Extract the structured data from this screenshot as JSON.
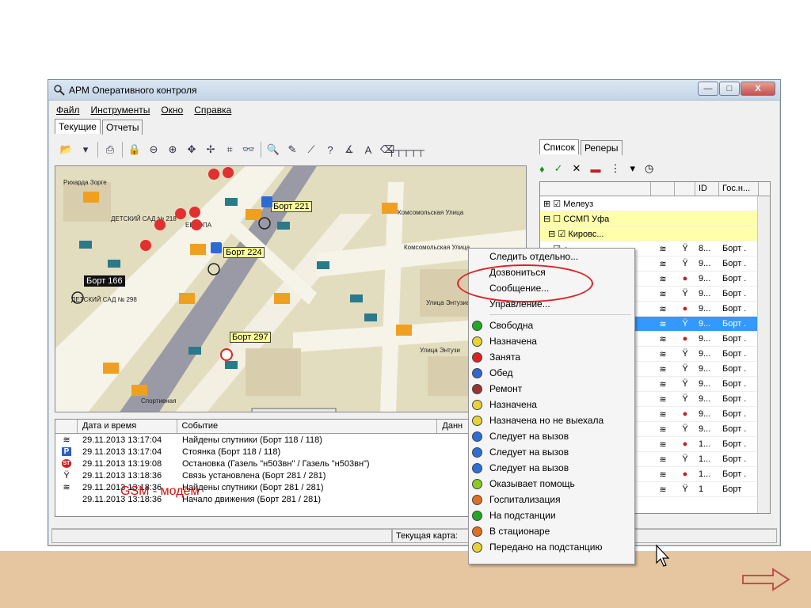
{
  "window": {
    "title": "АРМ Оперативного контроля",
    "buttons": {
      "minimize": "—",
      "maximize": "□",
      "close": "X"
    }
  },
  "menu": [
    "Файл",
    "Инструменты",
    "Окно",
    "Справка"
  ],
  "tabs": [
    "Текущие",
    "Отчеты"
  ],
  "map": {
    "streets": [
      "Рихарда Зорге",
      "Комсомольская Улица",
      "Комсомольская Улица",
      "Улица Энтузиаст",
      "Улица Энтузи",
      "Спортивная",
      "ДЕТСКИЙ САД № 218",
      "ДЕТСКИЙ САД № 298",
      "ЕВРОПА"
    ],
    "borts": [
      "Борт 221",
      "Борт 224",
      "Борт 166",
      "Борт 297"
    ]
  },
  "events": {
    "headers": [
      "Дата и время",
      "Событие",
      "Данн"
    ],
    "rows": [
      {
        "icon": "satellite-icon",
        "date": "29.11.2013 13:17:04",
        "event": "Найдены спутники (Борт 118 / 118)"
      },
      {
        "icon": "parking-icon",
        "date": "29.11.2013 13:17:04",
        "event": "Стоянка (Борт 118 / 118)"
      },
      {
        "icon": "stop-icon",
        "date": "29.11.2013 13:19:08",
        "event": "Остановка (Газель \"н503вн\" / Газель \"н503вн\")"
      },
      {
        "icon": "antenna-icon",
        "date": "29.11.2013 13:18:36",
        "event": "Связь установлена (Борт 281 / 281)"
      },
      {
        "icon": "satellite-icon",
        "date": "29.11.2013 13:18:36",
        "event": "Найдены спутники (Борт 281 / 281)"
      },
      {
        "icon": "none",
        "date": "29.11.2013 13:18:36",
        "event": "Начало движения (Борт 281 / 281)"
      }
    ]
  },
  "status": {
    "current_map": "Текущая карта: "
  },
  "right_panel": {
    "tabs": [
      "Список",
      "Реперы"
    ],
    "headers": [
      "ID",
      "Гос.н..."
    ],
    "tree": [
      {
        "label": "Мелеуз",
        "style": "plain"
      },
      {
        "label": "ССМП Уфа",
        "style": "yellow"
      },
      {
        "label": "Кировс...",
        "style": "yellow"
      }
    ],
    "rows": [
      {
        "id": "8...",
        "gos": "Борт ."
      },
      {
        "id": "9...",
        "gos": "Борт ."
      },
      {
        "id": "9...",
        "gos": "Борт ."
      },
      {
        "id": "9...",
        "gos": "Борт ."
      },
      {
        "id": "9...",
        "gos": "Борт ."
      },
      {
        "id": "9...",
        "gos": "Борт ."
      },
      {
        "id": "9...",
        "gos": "Борт ."
      },
      {
        "id": "9...",
        "gos": "Борт ."
      },
      {
        "id": "9...",
        "gos": "Борт ."
      },
      {
        "id": "9...",
        "gos": "Борт ."
      },
      {
        "id": "9...",
        "gos": "Борт ."
      },
      {
        "id": "9...",
        "gos": "Борт ."
      },
      {
        "id": "9...",
        "gos": "Борт ."
      },
      {
        "id": "1...",
        "gos": "Борт ."
      },
      {
        "id": "1...",
        "gos": "Борт ."
      },
      {
        "id": "1...",
        "gos": "Борт ."
      },
      {
        "id": "1",
        "gos": "Борт"
      }
    ]
  },
  "context_menu": {
    "top_items": [
      "Следить отдельно...",
      "Дозвониться",
      "Сообщение...",
      "Управление..."
    ],
    "status_items": [
      {
        "label": "Свободна",
        "color": "#22aa22"
      },
      {
        "label": "Назначена",
        "color": "#e8d23a"
      },
      {
        "label": "Занята",
        "color": "#e02020"
      },
      {
        "label": "Обед",
        "color": "#3366cc"
      },
      {
        "label": "Ремонт",
        "color": "#993333"
      },
      {
        "label": "Назначена",
        "color": "#e8d23a"
      },
      {
        "label": "Назначена но не выехала",
        "color": "#e8d23a"
      },
      {
        "label": "Следует на вызов",
        "color": "#2d6fd6"
      },
      {
        "label": "Следует на вызов",
        "color": "#2d6fd6"
      },
      {
        "label": "Следует на вызов",
        "color": "#2d6fd6"
      },
      {
        "label": "Оказывает помощь",
        "color": "#88cc22"
      },
      {
        "label": "Госпитализация",
        "color": "#e07020"
      },
      {
        "label": "На подстанции",
        "color": "#22aa22"
      },
      {
        "label": "В стационаре",
        "color": "#e07020"
      },
      {
        "label": "Передано на подстанцию",
        "color": "#e8d23a"
      }
    ]
  },
  "annotation": {
    "gsm_label": "GSM - модем"
  }
}
